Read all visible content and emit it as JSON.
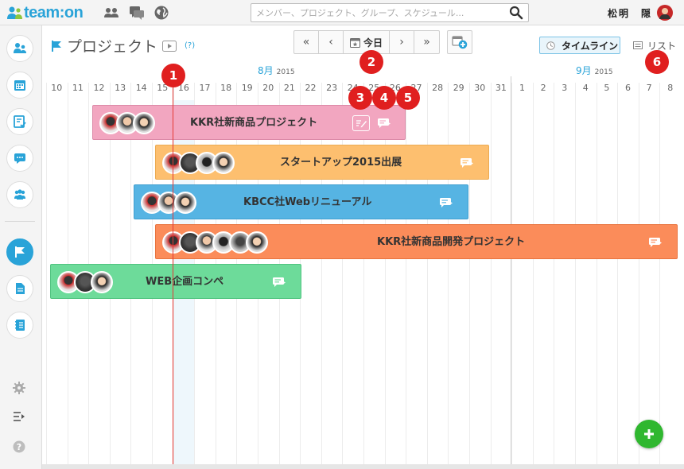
{
  "app": {
    "logo_text": "team:on"
  },
  "search": {
    "placeholder": "メンバー、プロジェクト、グループ、スケジュール..."
  },
  "user": {
    "name": "松明　隠"
  },
  "page": {
    "title": "プロジェクト",
    "help": "(?)"
  },
  "nav": {
    "today_label": "今日",
    "first": "«",
    "prev": "‹",
    "next": "›",
    "last": "»"
  },
  "views": {
    "timeline": "タイムライン",
    "list": "リスト"
  },
  "months": [
    {
      "label": "8月",
      "year": "2015"
    },
    {
      "label": "9月",
      "year": "2015"
    }
  ],
  "days": [
    "10",
    "11",
    "12",
    "13",
    "14",
    "15",
    "16",
    "17",
    "18",
    "19",
    "20",
    "21",
    "22",
    "23",
    "24",
    "25",
    "26",
    "27",
    "28",
    "29",
    "30",
    "31",
    "1",
    "2",
    "3",
    "4",
    "5",
    "6",
    "7",
    "8"
  ],
  "projects": [
    {
      "title": "KKR社新商品プロジェクト",
      "color": "#f2a6c0",
      "members": 3
    },
    {
      "title": "スタートアップ2015出展",
      "color": "#fdbf6f",
      "members": 4
    },
    {
      "title": "KBCC社Webリニューアル",
      "color": "#56b4e3",
      "members": 3
    },
    {
      "title": "KKR社新商品開発プロジェクト",
      "color": "#fb8c5a",
      "members": 6
    },
    {
      "title": "WEB企画コンペ",
      "color": "#6ddb9a",
      "members": 3
    }
  ],
  "badges": [
    "1",
    "2",
    "3",
    "4",
    "5",
    "6"
  ],
  "colors": {
    "accent": "#29a3d8",
    "badge": "#e01f1f",
    "fab": "#2fb72f",
    "today_line": "#e53935"
  }
}
